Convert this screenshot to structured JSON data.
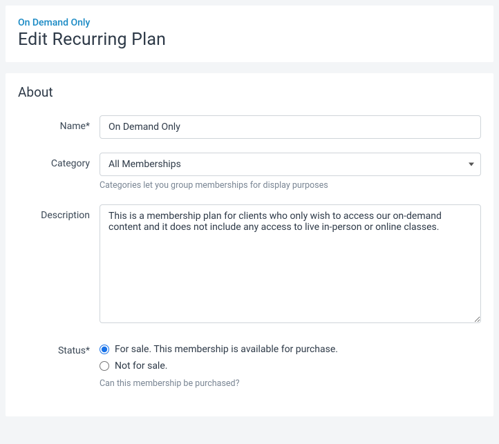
{
  "header": {
    "plan_link": "On Demand Only",
    "page_title": "Edit Recurring Plan"
  },
  "about": {
    "section_title": "About",
    "name": {
      "label": "Name*",
      "value": "On Demand Only"
    },
    "category": {
      "label": "Category",
      "selected": "All Memberships",
      "help": "Categories let you group memberships for display purposes"
    },
    "description": {
      "label": "Description",
      "value": "This is a membership plan for clients who only wish to access our on-demand content and it does not include any access to live in-person or online classes."
    },
    "status": {
      "label": "Status*",
      "options": [
        {
          "label": "For sale. This membership is available for purchase.",
          "checked": true
        },
        {
          "label": "Not for sale.",
          "checked": false
        }
      ],
      "help": "Can this membership be purchased?"
    }
  }
}
